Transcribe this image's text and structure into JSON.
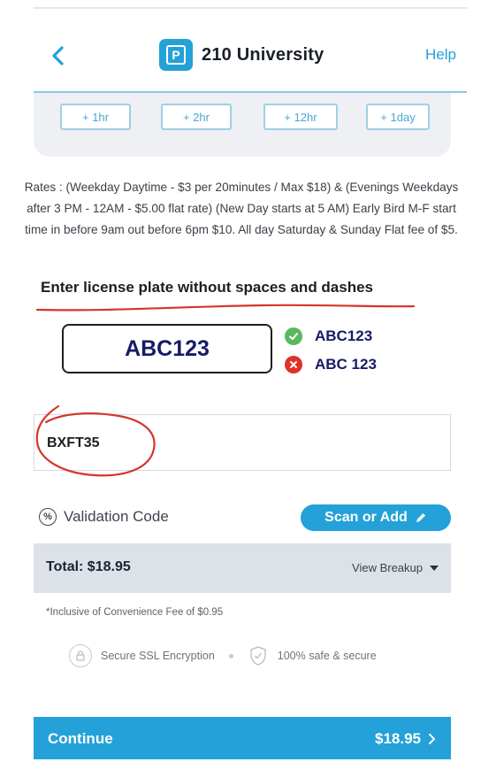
{
  "header": {
    "title": "210 University",
    "help_label": "Help",
    "badge_letter": "P"
  },
  "durations": [
    {
      "label": "+ 1hr"
    },
    {
      "label": "+ 2hr"
    },
    {
      "label": "+ 12hr"
    },
    {
      "label": "+ 1day"
    }
  ],
  "rates_text": "Rates : (Weekday Daytime - $3 per 20minutes / Max $18) & (Evenings Weekdays after 3 PM - 12AM - $5.00 flat rate) (New Day starts at 5 AM) Early Bird M-F start time in before 9am out before 6pm $10. All day Saturday & Sunday Flat fee of $5.",
  "plate": {
    "instruction": "Enter license plate without spaces and dashes",
    "example_box": "ABC123",
    "good_example": "ABC123",
    "bad_example": "ABC 123",
    "input_value": "BXFT35"
  },
  "validation": {
    "label": "Validation Code",
    "scan_label": "Scan or Add"
  },
  "total": {
    "label": "Total: $18.95",
    "breakup_label": "View Breakup"
  },
  "fee_note": "*Inclusive of Convenience Fee of $0.95",
  "security": {
    "ssl_label": "Secure SSL Encryption",
    "safe_label": "100% safe & secure"
  },
  "continue": {
    "label": "Continue",
    "price": "$18.95"
  },
  "colors": {
    "accent": "#23a1d8",
    "plate_text": "#161b66",
    "annotation_red": "#d7352c",
    "good": "#58b95c",
    "bad": "#e0312a"
  }
}
